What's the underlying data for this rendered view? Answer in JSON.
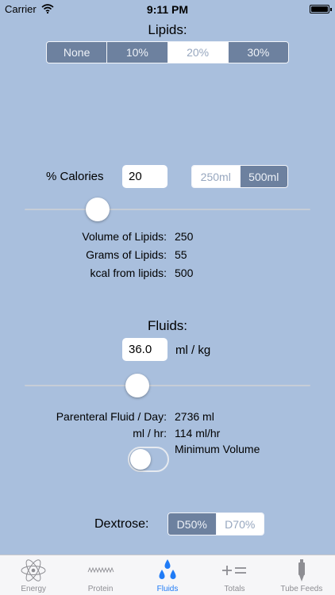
{
  "status_bar": {
    "carrier": "Carrier",
    "time": "9:11 PM"
  },
  "lipids": {
    "heading": "Lipids:",
    "options": [
      "None",
      "10%",
      "20%",
      "30%"
    ],
    "selected": "20%",
    "calories_label": "% Calories",
    "calories_value": "20",
    "volume_options": [
      "250ml",
      "500ml"
    ],
    "volume_selected": "500ml",
    "slider_fraction": 0.2,
    "results": [
      {
        "label": "Volume of Lipids:",
        "value": "250"
      },
      {
        "label": "Grams of Lipids:",
        "value": "55"
      },
      {
        "label": "kcal from lipids:",
        "value": "500"
      }
    ]
  },
  "fluids": {
    "heading": "Fluids:",
    "input_value": "36.0",
    "unit": "ml / kg",
    "slider_fraction": 0.34,
    "results": [
      {
        "label": "Parenteral Fluid / Day:",
        "value": "2736 ml"
      },
      {
        "label": "ml / hr:",
        "value": "114 ml/hr"
      }
    ],
    "min_volume_label": "Minimum Volume",
    "min_volume_on": false
  },
  "dextrose": {
    "label": "Dextrose:",
    "options": [
      "D50%",
      "D70%"
    ],
    "selected": "D50%"
  },
  "tabs": [
    {
      "label": "Energy",
      "icon": "atom-icon"
    },
    {
      "label": "Protein",
      "icon": "protein-chain-icon"
    },
    {
      "label": "Fluids",
      "icon": "droplets-icon"
    },
    {
      "label": "Totals",
      "icon": "plus-equals-icon"
    },
    {
      "label": "Tube Feeds",
      "icon": "syringe-icon"
    }
  ],
  "active_tab": "Fluids",
  "colors": {
    "background": "#a9bfdd",
    "segment_dark": "#6d819f",
    "tab_active": "#1f7bf6",
    "tab_inactive": "#8e8e93"
  }
}
